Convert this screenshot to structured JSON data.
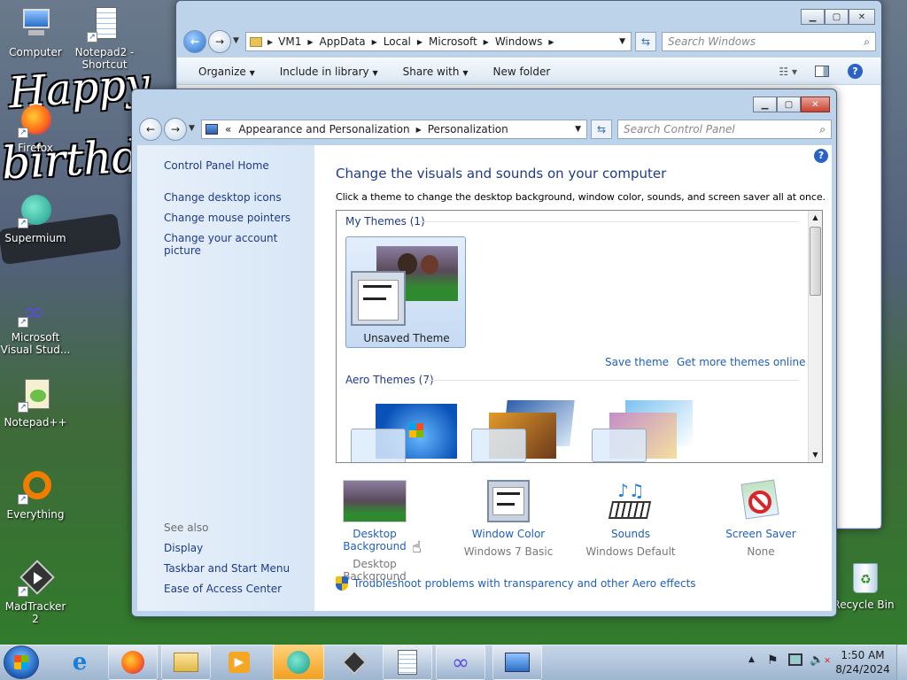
{
  "desktop": {
    "icons": [
      {
        "label": "Computer",
        "icon": "computer-icon"
      },
      {
        "label": "Notepad2 -\nShortcut",
        "icon": "notepad-icon"
      },
      {
        "label": "Firefox",
        "icon": "firefox-icon"
      },
      {
        "label": "Supermium",
        "icon": "supermium-icon"
      },
      {
        "label": "Microsoft\nVisual Stud...",
        "icon": "visual-studio-icon"
      },
      {
        "label": "Notepad++",
        "icon": "notepadpp-icon"
      },
      {
        "label": "Everything",
        "icon": "everything-icon"
      },
      {
        "label": "MadTracker 2",
        "icon": "madtracker-icon"
      },
      {
        "label": "Recycle Bin",
        "icon": "recycle-bin-icon"
      }
    ],
    "wallpaper_text": [
      "Happy",
      "birthday"
    ]
  },
  "explorer": {
    "breadcrumb": [
      "VM1",
      "AppData",
      "Local",
      "Microsoft",
      "Windows"
    ],
    "search_placeholder": "Search Windows",
    "toolbar": {
      "organize": "Organize",
      "include": "Include in library",
      "share": "Share with",
      "new_folder": "New folder"
    }
  },
  "cp": {
    "breadcrumb": [
      "Appearance and Personalization",
      "Personalization"
    ],
    "breadcrumb_prefix": "«",
    "search_placeholder": "Search Control Panel",
    "sidebar": {
      "home": "Control Panel Home",
      "links": [
        "Change desktop icons",
        "Change mouse pointers",
        "Change your account picture"
      ],
      "see_also_title": "See also",
      "see_also": [
        "Display",
        "Taskbar and Start Menu",
        "Ease of Access Center"
      ]
    },
    "title": "Change the visuals and sounds on your computer",
    "description": "Click a theme to change the desktop background, window color, sounds, and screen saver all at once.",
    "my_themes": {
      "header": "My Themes (1)",
      "theme_label": "Unsaved Theme"
    },
    "save_theme": "Save theme",
    "get_more": "Get more themes online",
    "aero_themes": {
      "header": "Aero Themes (7)"
    },
    "options": [
      {
        "label": "Desktop Background",
        "value": "Desktop Background",
        "icon": "desktop-background-icon"
      },
      {
        "label": "Window Color",
        "value": "Windows 7 Basic",
        "icon": "window-color-icon"
      },
      {
        "label": "Sounds",
        "value": "Windows Default",
        "icon": "sounds-icon"
      },
      {
        "label": "Screen Saver",
        "value": "None",
        "icon": "screen-saver-icon"
      }
    ],
    "troubleshoot": "Troubleshoot problems with transparency and other Aero effects"
  },
  "taskbar": {
    "time": "1:50 AM",
    "date": "8/24/2024",
    "items": [
      "internet-explorer-icon",
      "firefox-icon",
      "file-explorer-icon",
      "media-player-icon",
      "supermium-icon",
      "madtracker-icon",
      "notepad-icon",
      "visual-studio-icon",
      "control-panel-icon"
    ]
  },
  "colors": {
    "link": "#1f5fbf",
    "heading": "#1e3a8a",
    "window_frame": "#bcd3ea",
    "taskbar": "#9fb6d0"
  }
}
